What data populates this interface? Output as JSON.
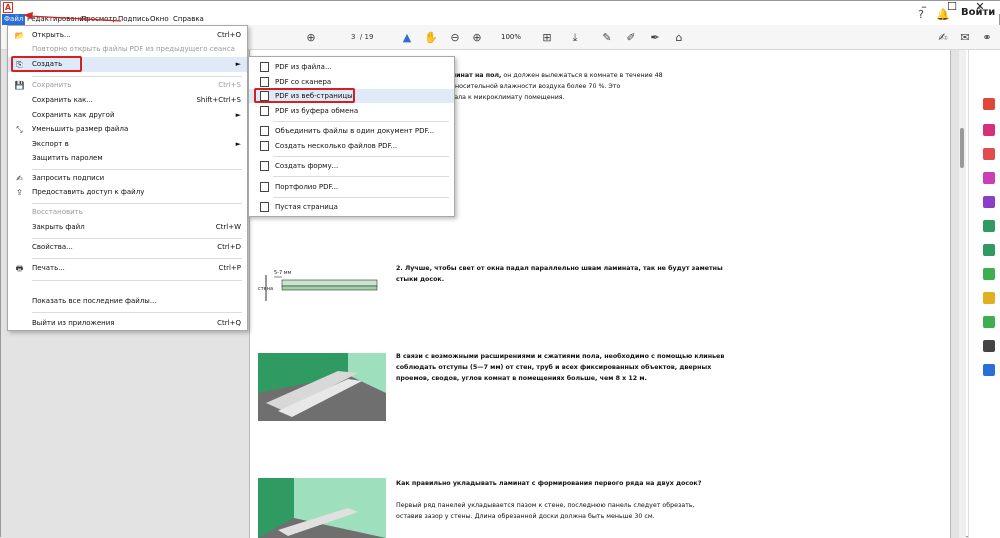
{
  "menubar": [
    "Файл",
    "Редактирование",
    "Просмотр",
    "Подпись",
    "Окно",
    "Справка"
  ],
  "toolbar": {
    "page_current": "3",
    "page_total": "/ 19",
    "zoom": "100%",
    "sign_in": "Войти"
  },
  "file_menu": [
    {
      "label": "Открыть...",
      "shortcut": "Ctrl+O",
      "disabled": false
    },
    {
      "label": "Повторно открыть файлы PDF из предыдущего сеанса",
      "shortcut": "",
      "disabled": true
    },
    {
      "label": "Создать",
      "shortcut": "►",
      "disabled": false
    },
    {
      "label": "Сохранить",
      "shortcut": "Ctrl+S",
      "disabled": true
    },
    {
      "label": "Сохранить как...",
      "shortcut": "Shift+Ctrl+S",
      "disabled": false
    },
    {
      "label": "Сохранить как другой",
      "shortcut": "►",
      "disabled": false
    },
    {
      "label": "Уменьшить размер файла",
      "shortcut": "",
      "disabled": false
    },
    {
      "label": "Экспорт в",
      "shortcut": "►",
      "disabled": false
    },
    {
      "label": "Защитить паролем",
      "shortcut": "",
      "disabled": false
    },
    {
      "label": "Запросить подписи",
      "shortcut": "",
      "disabled": false
    },
    {
      "label": "Предоставить доступ к файлу",
      "shortcut": "",
      "disabled": false
    },
    {
      "label": "Восстановить",
      "shortcut": "",
      "disabled": true
    },
    {
      "label": "Закрыть файл",
      "shortcut": "Ctrl+W",
      "disabled": false
    },
    {
      "label": "Свойства...",
      "shortcut": "Ctrl+D",
      "disabled": false
    },
    {
      "label": "Печать...",
      "shortcut": "Ctrl+P",
      "disabled": false
    },
    {
      "label": "Показать все последние файлы...",
      "shortcut": "",
      "disabled": false
    },
    {
      "label": "Выйти из приложения",
      "shortcut": "Ctrl+Q",
      "disabled": false
    }
  ],
  "create_submenu": [
    "PDF из файла...",
    "PDF со сканера",
    "PDF из веб-страницы",
    "PDF из буфера обмена",
    "Объединить файлы в один документ PDF...",
    "Создать несколько файлов PDF...",
    "Создать форму...",
    "Портфолио PDF...",
    "Пустая страница"
  ],
  "document": {
    "p1_bold": "укладывать ламинат на пол,",
    "p1_rest": " он должен вылежаться в комнате в течение 48",
    "p1_line2": "температуре и относительной влажности воздуха более 70 %. Это",
    "p1_line3": "лоптации материала к микроклимату помещения.",
    "p2_line1": "2. Лучше, чтобы свет от окна падал параллельно швам ламината, так не будут заметны",
    "p2_line2": "стыки досок.",
    "p3_line1": "В связи с возможными расширениями и сжатиями пола, необходимо с помощью клиньев",
    "p3_line2": "соблюдать отступы (5—7 мм) от стен, труб и всех фиксированных объектов, дверных",
    "p3_line3": "проемов, сводов, углов комнат в помещениях больше, чем 8 х 12 м.",
    "p4_title": "Как правильно укладывать ламинат с формирования первого ряда на двух досок?",
    "p4_line1": "Первый ряд панелей укладывается пазом к стене, последнюю панель следует обрезать,",
    "p4_line2": "оставив зазор у стены. Длина обрезанной доски должна быть меньше 30 см.",
    "fig_label_mm": "5-7 мм",
    "fig_label_wall": "стена"
  }
}
